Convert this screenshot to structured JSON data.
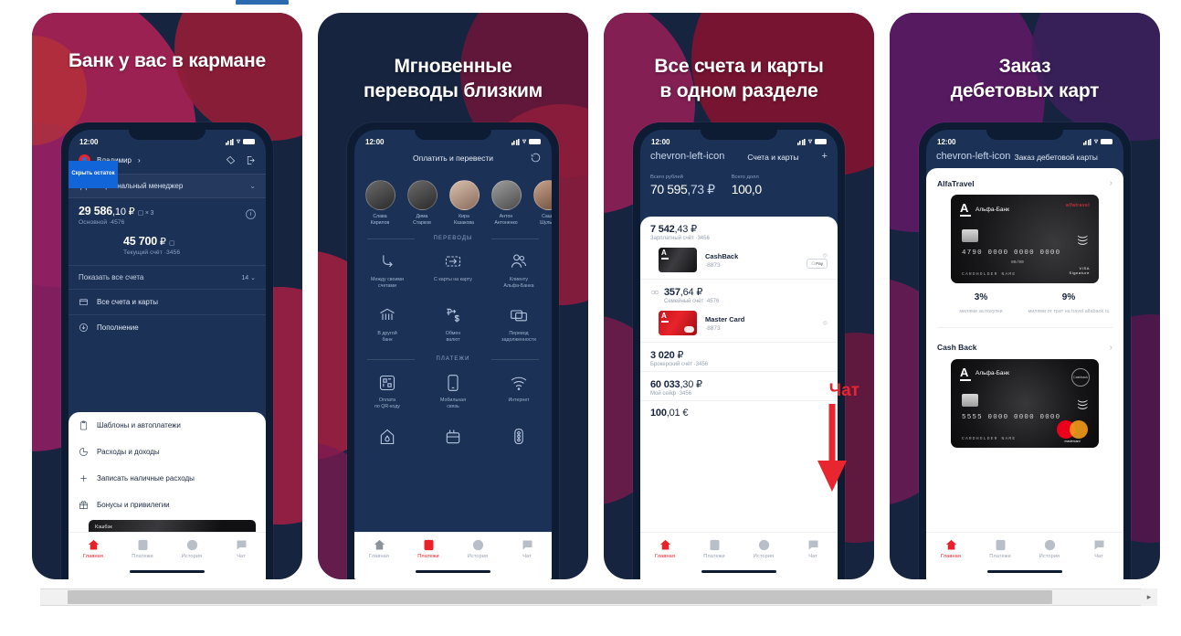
{
  "app": {
    "status_time": "12:00",
    "nav_tabs": [
      {
        "label": "Главная",
        "icon": "home-icon"
      },
      {
        "label": "Платежи",
        "icon": "payments-icon"
      },
      {
        "label": "История",
        "icon": "history-icon"
      },
      {
        "label": "Чат",
        "icon": "chat-icon"
      }
    ]
  },
  "screens": [
    {
      "headline": "Банк у вас в кармане",
      "active_tab": 0,
      "user": {
        "name": "Владимир",
        "chevron": "›"
      },
      "manager_row": "Персональный менеджер",
      "accounts": [
        {
          "amount_int": "29 586",
          "amount_dec": ",10 ₽",
          "sub": "Основной  ·4576",
          "cards_badge": "× 3"
        },
        {
          "amount_int": "45 700",
          "amount_dec": " ₽",
          "sub": "Текущий счёт ·3456"
        }
      ],
      "hide_balance_button": "Скрыть остаток",
      "show_all": {
        "label": "Показать все счета",
        "count": "14"
      },
      "dark_items": [
        {
          "label": "Все счета и карты",
          "icon": "wallet-icon"
        },
        {
          "label": "Пополнение",
          "icon": "download-icon"
        }
      ],
      "light_items": [
        {
          "label": "Шаблоны и автоплатежи",
          "icon": "clipboard-icon"
        },
        {
          "label": "Расходы и доходы",
          "icon": "pie-icon"
        },
        {
          "label": "Записать наличные расходы",
          "icon": "plus-icon"
        },
        {
          "label": "Бонусы и привилегии",
          "icon": "gift-icon"
        }
      ],
      "promo_card": "Кэшбэк"
    },
    {
      "headline_lines": [
        "Мгновенные",
        "переводы близким"
      ],
      "active_tab": 1,
      "title": "Оплатить и перевести",
      "history_icon": "history-circle-icon",
      "contacts": [
        {
          "name_1": "Слава",
          "name_2": "Кирилов"
        },
        {
          "name_1": "Дима",
          "name_2": "Старков"
        },
        {
          "name_1": "Кира",
          "name_2": "Казакова"
        },
        {
          "name_1": "Антон",
          "name_2": "Антоненко"
        },
        {
          "name_1": "Саша",
          "name_2": "Шульга"
        }
      ],
      "sections": [
        {
          "title": "ПЕРЕВОДЫ",
          "items": [
            {
              "label_1": "Между своими",
              "label_2": "счетами",
              "icon": "arrow-loop-icon"
            },
            {
              "label_1": "С карты на карту",
              "label_2": "",
              "icon": "card-transfer-icon"
            },
            {
              "label_1": "Клиенту",
              "label_2": "Альфа-Банка",
              "icon": "people-icon"
            },
            {
              "label_1": "В другой",
              "label_2": "банк",
              "icon": "bank-icon"
            },
            {
              "label_1": "Обмен",
              "label_2": "валют",
              "icon": "currency-exchange-icon"
            },
            {
              "label_1": "Перевод",
              "label_2": "задолженности",
              "icon": "cards-stack-icon"
            }
          ]
        },
        {
          "title": "ПЛАТЕЖИ",
          "items": [
            {
              "label_1": "Оплата",
              "label_2": "по QR-коду",
              "icon": "qr-code-icon"
            },
            {
              "label_1": "Мобильная",
              "label_2": "связь",
              "icon": "phone-icon"
            },
            {
              "label_1": "Интернет",
              "label_2": "",
              "icon": "wifi-icon"
            },
            {
              "label_1": "",
              "label_2": "",
              "icon": "house-water-icon"
            },
            {
              "label_1": "",
              "label_2": "",
              "icon": "utilities-icon"
            },
            {
              "label_1": "",
              "label_2": "",
              "icon": "traffic-light-icon"
            }
          ]
        }
      ]
    },
    {
      "headline_lines": [
        "Все счета и карты",
        "в одном разделе"
      ],
      "active_tab": 0,
      "title": "Счета и карты",
      "back_icon": "chevron-left-icon",
      "add_icon": "plus-icon",
      "totals": [
        {
          "label": "Всего рублей",
          "value_int": "70 595",
          "value_dec": ",73 ₽"
        },
        {
          "label": "Всего долл",
          "value_int": "100,0",
          "value_dec": ""
        }
      ],
      "annotation": {
        "text": "Чат",
        "color": "#e8262f"
      },
      "rows": [
        {
          "amount_int": "7 542",
          "amount_dec": ",43 ₽",
          "sub": "Зарплатный счёт ·3456",
          "card": {
            "name": "CashBack",
            "number": "·8873",
            "style": "black",
            "applepay": "Pay"
          }
        },
        {
          "amount_int": "357",
          "amount_dec": ",64 ₽",
          "sub": "Семейный счёт  ·4576",
          "leading_icon": "cards-icon",
          "card": {
            "name": "Master Card",
            "number": "·8873",
            "style": "red",
            "applepay": ""
          }
        },
        {
          "amount_int": "3 020",
          "amount_dec": " ₽",
          "sub": "Брокерский счёт ·3456"
        },
        {
          "amount_int": "60 033",
          "amount_dec": ",30 ₽",
          "sub": "Мой сейф  ·3456"
        },
        {
          "amount_int": "100",
          "amount_dec": ",01 €",
          "sub": ""
        }
      ]
    },
    {
      "headline_lines": [
        "Заказ",
        "дебетовых карт"
      ],
      "active_tab": 0,
      "title": "Заказ дебетовой карты",
      "back_icon": "chevron-left-icon",
      "groups": [
        {
          "name": "AlfaTravel",
          "chevron": "›",
          "card": {
            "bank": "Альфа-Банк",
            "brandmark": "alfatravel",
            "number": "4790 0000 0000 0000",
            "expiry": "00/00",
            "holder": "CARDHOLDER NAME",
            "network": "VISA",
            "network_sub": "Signature",
            "style": "travel"
          },
          "perks": [
            {
              "value": "3%",
              "desc": "милями за покупки"
            },
            {
              "value": "9%",
              "desc": "милями от трат на travel.alfabank.ru"
            }
          ]
        },
        {
          "name": "Cash Back",
          "chevron": "›",
          "card": {
            "bank": "Альфа-Банк",
            "brandmark": "Cashback",
            "number": "5555 0000 0000 0000",
            "expiry": "00/00",
            "holder": "CARDHOLDER NAME",
            "network": "mastercard",
            "network_sub": "",
            "style": "cashback"
          },
          "perks": []
        }
      ]
    }
  ],
  "scrollbar": {
    "left_arrow": "◂",
    "right_arrow": "▸"
  },
  "colors": {
    "brand_red": "#ea2129",
    "accent_blue": "#1265d8",
    "dark_navy": "#16243f",
    "screen_navy": "#1b3156"
  }
}
